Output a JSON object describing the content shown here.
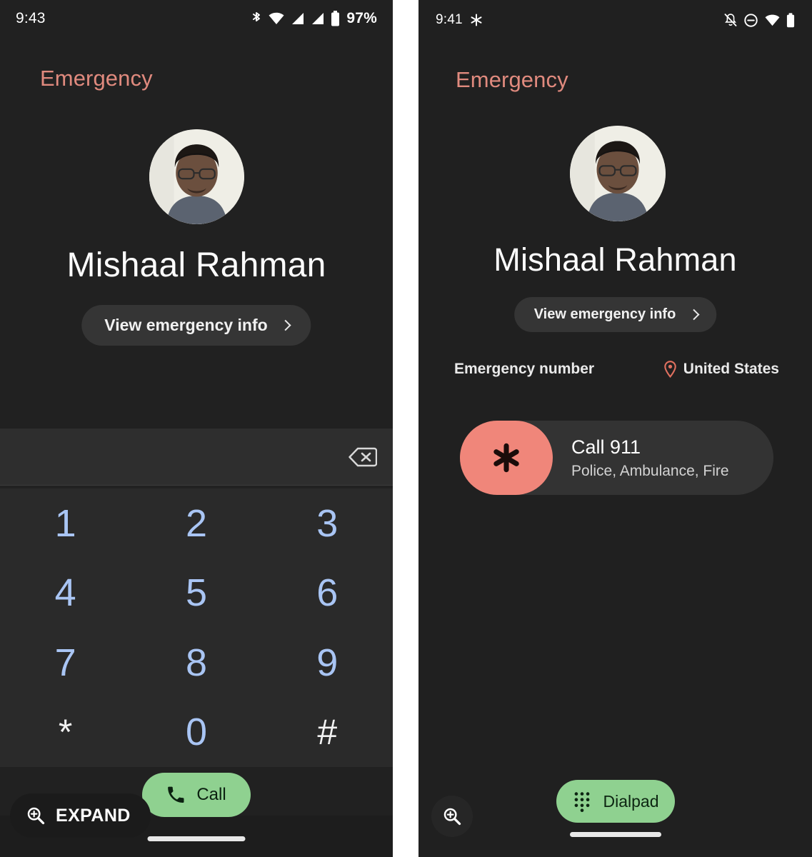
{
  "left_phone": {
    "statusbar": {
      "time": "9:43",
      "battery_percent": "97%",
      "icons": [
        "bluetooth-icon",
        "wifi-icon",
        "cellular-signal-icon",
        "cellular-signal-2-icon",
        "battery-icon"
      ]
    },
    "header": {
      "emergency_label": "Emergency",
      "person_name": "Mishaal Rahman",
      "emergency_info_label": "View emergency info",
      "chevron": "chevron-right-icon",
      "avatar_alt": "contact-photo"
    },
    "dialpad": {
      "entered_number": "",
      "backspace_icon": "backspace-icon",
      "keys": [
        {
          "label": "1",
          "type": "digit"
        },
        {
          "label": "2",
          "type": "digit"
        },
        {
          "label": "3",
          "type": "digit"
        },
        {
          "label": "4",
          "type": "digit"
        },
        {
          "label": "5",
          "type": "digit"
        },
        {
          "label": "6",
          "type": "digit"
        },
        {
          "label": "7",
          "type": "digit"
        },
        {
          "label": "8",
          "type": "digit"
        },
        {
          "label": "9",
          "type": "digit"
        },
        {
          "label": "*",
          "type": "symbol"
        },
        {
          "label": "0",
          "type": "digit"
        },
        {
          "label": "#",
          "type": "symbol"
        }
      ]
    },
    "call_button": {
      "label": "Call",
      "icon": "phone-handset-icon"
    },
    "expand_chip": {
      "label": "EXPAND",
      "icon": "zoom-in-icon"
    }
  },
  "right_phone": {
    "statusbar": {
      "time": "9:41",
      "icons": [
        "snowflake-icon",
        "notifications-off-icon",
        "do-not-disturb-icon",
        "wifi-icon",
        "battery-icon"
      ]
    },
    "header": {
      "emergency_label": "Emergency",
      "person_name": "Mishaal Rahman",
      "emergency_info_label": "View emergency info",
      "chevron": "chevron-right-icon",
      "avatar_alt": "contact-photo"
    },
    "section": {
      "label": "Emergency number",
      "country": "United States",
      "location_icon": "location-pin-icon"
    },
    "emergency_entry": {
      "title": "Call 911",
      "subtitle": "Police, Ambulance, Fire",
      "badge_icon": "star-of-life-icon"
    },
    "dialpad_button": {
      "label": "Dialpad",
      "icon": "dialpad-grid-icon"
    },
    "zoom_fab": {
      "icon": "zoom-in-icon"
    }
  },
  "colors": {
    "emergency_red": "#e08a7e",
    "badge_salmon": "#f0867a",
    "call_green": "#8fd190",
    "dial_blue": "#a9c5f4",
    "panel_bg": "#202020",
    "keypad_bg": "#2a2a2a"
  }
}
